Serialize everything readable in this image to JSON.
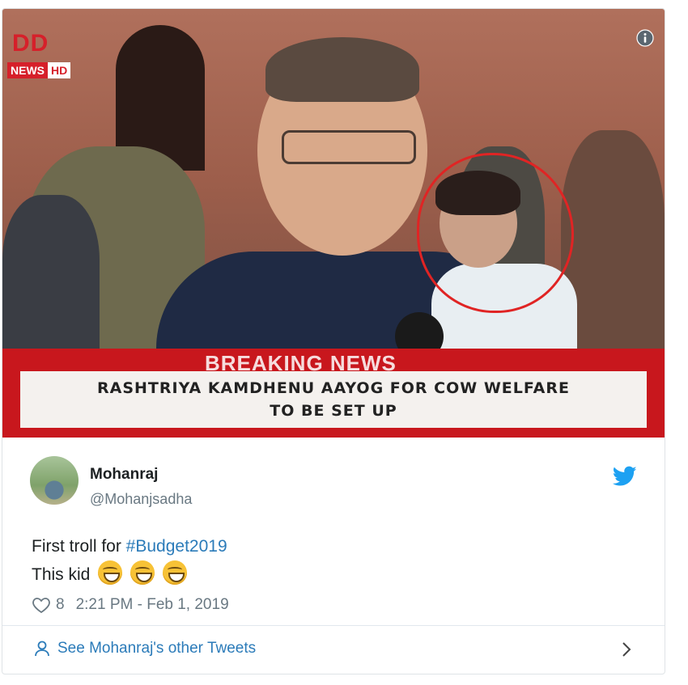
{
  "media": {
    "channel_logo": "DD",
    "channel_sub_left": "NEWS",
    "channel_sub_right": "HD",
    "banner_title": "BREAKING NEWS",
    "ticker_line1": "RASHTRIYA KAMDHENU AAYOG FOR COW WELFARE",
    "ticker_line2": "TO BE SET UP",
    "icons": [
      "info-icon"
    ]
  },
  "author": {
    "name": "Mohanraj",
    "handle": "@Mohanjsadha"
  },
  "tweet": {
    "text_prefix": "First troll for ",
    "hashtag": "#Budget2019",
    "line2": "This kid",
    "emoji_name": "grinning-face-with-smiling-eyes",
    "emoji_count": 3
  },
  "meta": {
    "likes": "8",
    "timestamp": "2:21 PM - Feb 1, 2019"
  },
  "footer": {
    "other_tweets_label": "See Mohanraj's other Tweets"
  },
  "colors": {
    "link_blue": "#2b7bb9",
    "twitter_blue": "#1da1f2",
    "breaking_red": "#c8171d",
    "circle_red": "#e02424"
  }
}
